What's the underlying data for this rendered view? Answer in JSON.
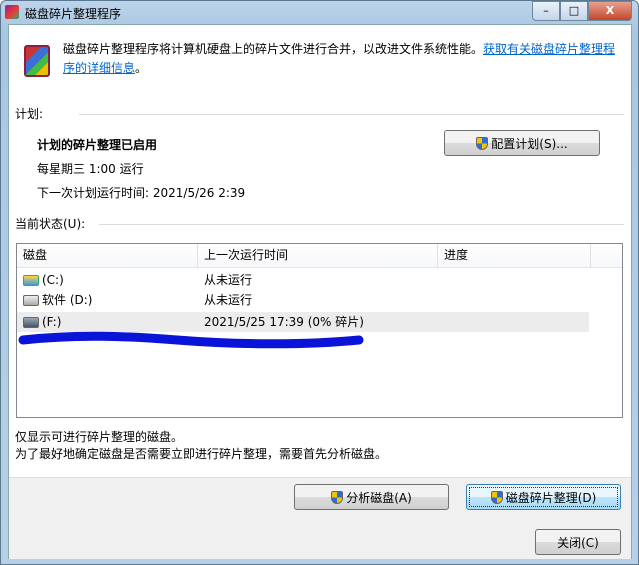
{
  "window": {
    "title": "磁盘碎片整理程序",
    "minimize": "–",
    "maximize": "□",
    "close": "X"
  },
  "intro": {
    "text": "磁盘碎片整理程序将计算机硬盘上的碎片文件进行合并，以改进文件系统性能。",
    "link_part1": "获取有关磁盘碎片整理程",
    "link_part2": "序的详细信息",
    "end": "。"
  },
  "schedule": {
    "heading": "计划:",
    "status": "计划的碎片整理已启用",
    "frequency": "每星期三  1:00 运行",
    "next_run": "下一次计划运行时间: 2021/5/26 2:39",
    "configure_button": "配置计划(S)..."
  },
  "current_status": {
    "heading": "当前状态(U):",
    "columns": [
      "磁盘",
      "上一次运行时间",
      "进度"
    ],
    "rows": [
      {
        "disk": "(C:)",
        "last_run": "从未运行",
        "progress": "",
        "icon": "system-drive-icon"
      },
      {
        "disk": "软件 (D:)",
        "last_run": "从未运行",
        "progress": "",
        "icon": "drive-icon"
      },
      {
        "disk": "(F:)",
        "last_run": "2021/5/25 17:39 (0% 碎片)",
        "progress": "",
        "icon": "drive-icon",
        "selected": true
      }
    ]
  },
  "notes": [
    "仅显示可进行碎片整理的磁盘。",
    "为了最好地确定磁盘是否需要立即进行碎片整理，需要首先分析磁盘。"
  ],
  "buttons": {
    "analyze": "分析磁盘(A)",
    "defragment": "磁盘碎片整理(D)",
    "close": "关闭(C)"
  },
  "colors": {
    "link": "#0066cc",
    "scribble": "#0a14d8"
  }
}
